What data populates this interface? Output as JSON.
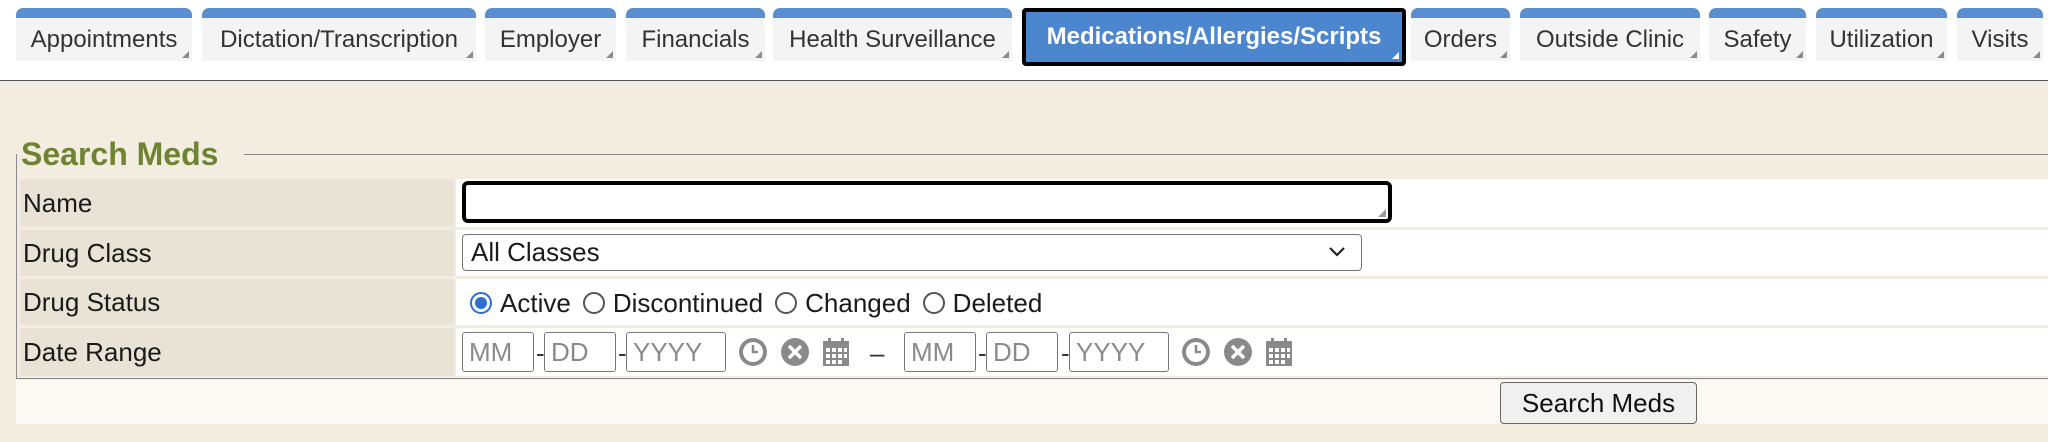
{
  "tabs": [
    {
      "label": "Appointments",
      "active": false
    },
    {
      "label": "Dictation/Transcription",
      "active": false
    },
    {
      "label": "Employer",
      "active": false
    },
    {
      "label": "Financials",
      "active": false
    },
    {
      "label": "Health Surveillance",
      "active": false
    },
    {
      "label": "Medications/Allergies/Scripts",
      "active": true
    },
    {
      "label": "Orders",
      "active": false
    },
    {
      "label": "Outside Clinic",
      "active": false
    },
    {
      "label": "Safety",
      "active": false
    },
    {
      "label": "Utilization",
      "active": false
    },
    {
      "label": "Visits",
      "active": false
    }
  ],
  "search": {
    "legend": "Search Meds",
    "name_label": "Name",
    "name_value": "",
    "drug_class_label": "Drug Class",
    "drug_class_value": "All Classes",
    "drug_status_label": "Drug Status",
    "drug_status_options": [
      {
        "label": "Active",
        "checked": true
      },
      {
        "label": "Discontinued",
        "checked": false
      },
      {
        "label": "Changed",
        "checked": false
      },
      {
        "label": "Deleted",
        "checked": false
      }
    ],
    "date_range_label": "Date Range",
    "date_placeholders": {
      "month": "MM",
      "day": "DD",
      "year": "YYYY"
    },
    "range_separator": "–",
    "button_label": "Search Meds"
  },
  "colors": {
    "tab_accent": "#5a8fcf",
    "active_tab": "#4b86cf",
    "legend": "#6e8433",
    "radio_selected": "#2a6fd1"
  }
}
